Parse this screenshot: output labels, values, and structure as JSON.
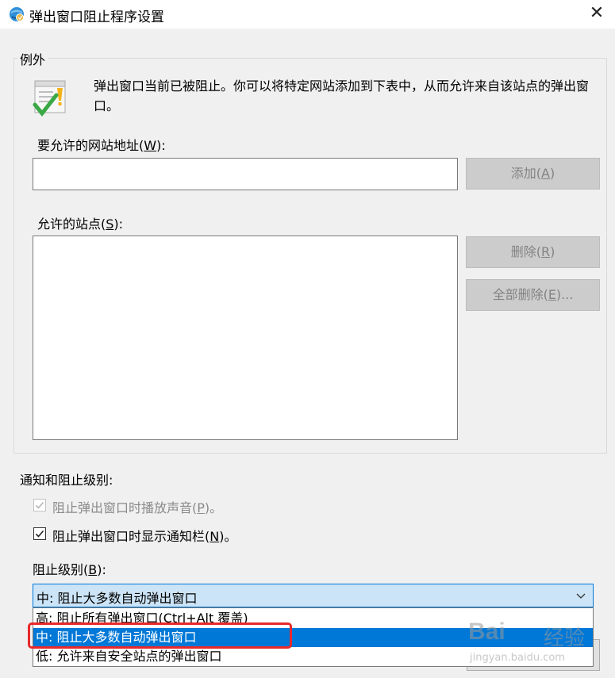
{
  "window": {
    "title": "弹出窗口阻止程序设置",
    "close_glyph": "✕"
  },
  "exceptions": {
    "group_label": "例外",
    "info_text": "弹出窗口当前已被阻止。你可以将特定网站添加到下表中，从而允许来自该站点的弹出窗口。",
    "address_label": "要允许的网站地址(",
    "address_key": "W",
    "address_suffix": "):",
    "address_value": "",
    "add_button": {
      "text": "添加(",
      "key": "A",
      "suffix": ")"
    },
    "allowed_label": "允许的站点(",
    "allowed_key": "S",
    "allowed_suffix": "):",
    "allowed_sites": [],
    "remove_button": {
      "text": "删除(",
      "key": "R",
      "suffix": ")"
    },
    "remove_all_button": {
      "text": "全部删除(",
      "key": "E",
      "suffix": ")..."
    }
  },
  "notifications": {
    "group_label": "通知和阻止级别:",
    "play_sound": {
      "text": "阻止弹出窗口时播放声音(",
      "key": "P",
      "suffix": ")。",
      "checked": true,
      "disabled": true
    },
    "show_bar": {
      "text": "阻止弹出窗口时显示通知栏(",
      "key": "N",
      "suffix": ")。",
      "checked": true,
      "disabled": false
    },
    "level_label": "阻止级别(",
    "level_key": "B",
    "level_suffix": "):",
    "level_selected": "中: 阻止大多数自动弹出窗口",
    "level_options": [
      "高: 阻止所有弹出窗口(Ctrl+Alt 覆盖)",
      "中: 阻止大多数自动弹出窗口",
      "低: 允许来自安全站点的弹出窗口"
    ]
  },
  "watermark": {
    "logo": "Bai",
    "cn": "经验",
    "url": "jingyan.baidu.com"
  },
  "colors": {
    "accent": "#0078d7",
    "highlight": "#e8282b"
  }
}
